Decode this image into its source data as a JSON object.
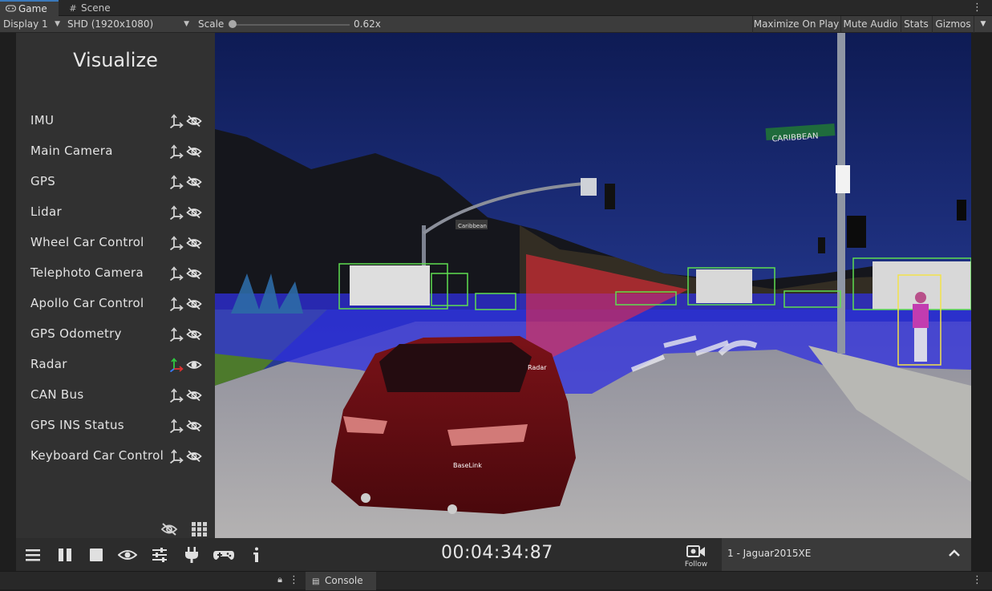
{
  "tabs": [
    {
      "label": "Game",
      "icon": "gamepad-icon",
      "active": true
    },
    {
      "label": "Scene",
      "icon": "grid-icon",
      "active": false
    }
  ],
  "toolbar": {
    "display": "Display 1",
    "resolution": "SHD (1920x1080)",
    "scale_label": "Scale",
    "scale_value": "0.62x",
    "scale_fraction": 0.0,
    "maximize": "Maximize On Play",
    "mute": "Mute Audio",
    "stats": "Stats",
    "gizmos": "Gizmos"
  },
  "visualize": {
    "title": "Visualize",
    "items": [
      {
        "label": "IMU",
        "visible": false
      },
      {
        "label": "Main Camera",
        "visible": false
      },
      {
        "label": "GPS",
        "visible": false
      },
      {
        "label": "Lidar",
        "visible": false
      },
      {
        "label": "Wheel Car Control",
        "visible": false
      },
      {
        "label": "Telephoto Camera",
        "visible": false
      },
      {
        "label": "Apollo Car Control",
        "visible": false
      },
      {
        "label": "GPS Odometry",
        "visible": false
      },
      {
        "label": "Radar",
        "visible": true
      },
      {
        "label": "CAN Bus",
        "visible": false
      },
      {
        "label": "GPS INS Status",
        "visible": false
      },
      {
        "label": "Keyboard Car Control",
        "visible": false
      }
    ]
  },
  "scene": {
    "street_sign": "CARIBBEAN",
    "small_sign": "Caribbean",
    "car_label_radar": "Radar",
    "car_label_baselink": "BaseLink"
  },
  "bottom": {
    "timer": "00:04:34:87",
    "follow_label": "Follow",
    "agent": "1 - Jaguar2015XE"
  },
  "status": {
    "console": "Console"
  },
  "colors": {
    "accent_blue": "#3a79bb",
    "radar_active": "#2ecc40"
  }
}
